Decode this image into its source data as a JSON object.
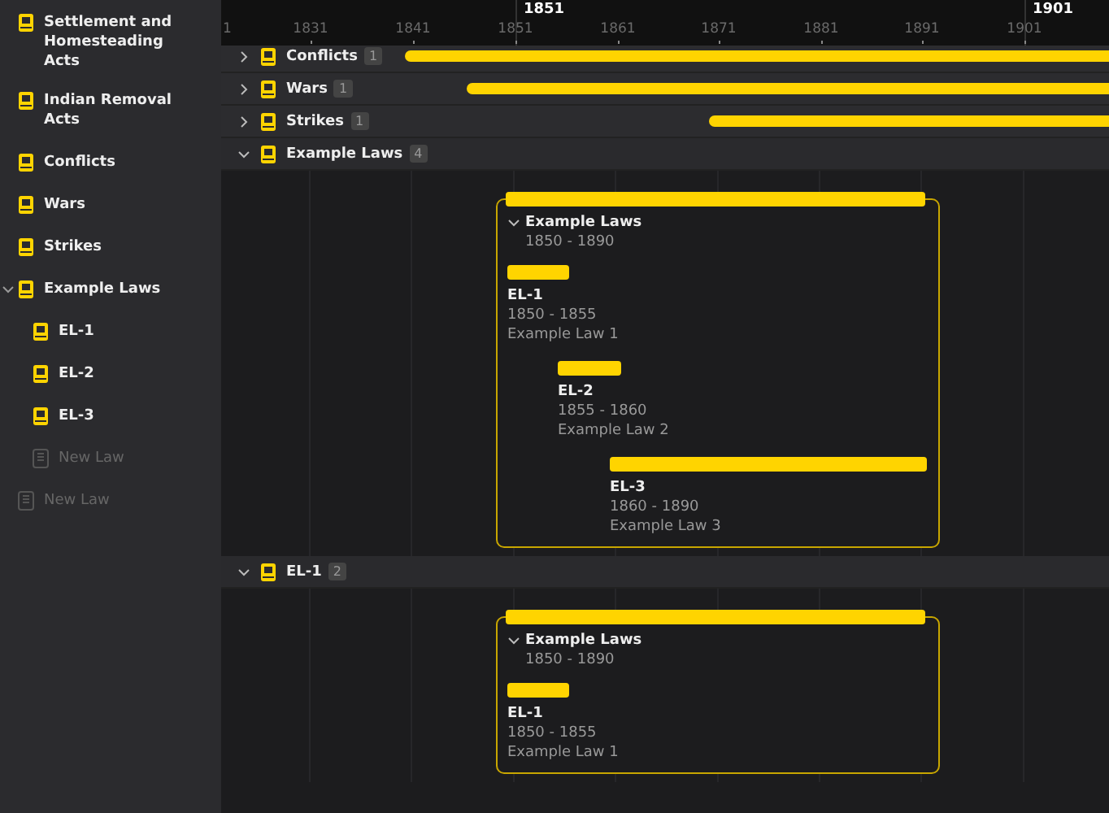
{
  "sidebar": {
    "items": [
      {
        "label": "Settlement and Homesteading Acts",
        "kind": "book"
      },
      {
        "label": "Indian Removal Acts",
        "kind": "book"
      },
      {
        "label": "Conflicts",
        "kind": "book"
      },
      {
        "label": "Wars",
        "kind": "book"
      },
      {
        "label": "Strikes",
        "kind": "book"
      },
      {
        "label": "Example Laws",
        "kind": "book",
        "expanded": true,
        "children": [
          {
            "label": "EL-1",
            "kind": "book"
          },
          {
            "label": "EL-2",
            "kind": "book"
          },
          {
            "label": "EL-3",
            "kind": "book"
          },
          {
            "label": "New Law",
            "kind": "new"
          }
        ]
      },
      {
        "label": "New Law",
        "kind": "new"
      }
    ]
  },
  "timeline": {
    "major_ticks": [
      "1851",
      "1901"
    ],
    "minor_ticks": [
      "1",
      "1831",
      "1841",
      "1851",
      "1861",
      "1871",
      "1881",
      "1891",
      "1901"
    ],
    "groups": [
      {
        "label": "Conflicts",
        "count": "1",
        "expanded": false
      },
      {
        "label": "Wars",
        "count": "1",
        "expanded": false
      },
      {
        "label": "Strikes",
        "count": "1",
        "expanded": false
      },
      {
        "label": "Example Laws",
        "count": "4",
        "expanded": true,
        "card": {
          "title": "Example Laws",
          "dates": "1850 - 1890",
          "expanded": true,
          "items": [
            {
              "title": "EL-1",
              "dates": "1850 - 1855",
              "description": "Example Law 1"
            },
            {
              "title": "EL-2",
              "dates": "1855 - 1860",
              "description": "Example Law 2"
            },
            {
              "title": "EL-3",
              "dates": "1860 - 1890",
              "description": "Example Law 3"
            }
          ]
        }
      },
      {
        "label": "EL-1",
        "count": "2",
        "expanded": true,
        "card": {
          "title": "Example Laws",
          "dates": "1850 - 1890",
          "expanded": true,
          "items": [
            {
              "title": "EL-1",
              "dates": "1850 - 1855",
              "description": "Example Law 1"
            }
          ]
        }
      }
    ]
  }
}
